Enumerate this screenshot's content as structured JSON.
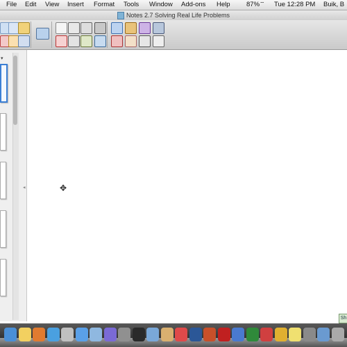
{
  "menubar": {
    "items": [
      "File",
      "Edit",
      "View",
      "Insert",
      "Format",
      "Tools",
      "Window",
      "Add-ons",
      "Help"
    ],
    "battery": "87%",
    "clock": "Tue 12:28 PM",
    "user": "Buik, B"
  },
  "window": {
    "title": "Notes 2.7 Solving Real Life Problems"
  },
  "sidebar": {
    "page_count_visible": 5,
    "selected_page": 1
  },
  "dock": {
    "apps": [
      "finder-icon",
      "notes-icon",
      "firefox-icon",
      "safari-icon",
      "launchpad-icon",
      "app-store-icon",
      "mail-icon",
      "itunes-icon",
      "system-prefs-icon",
      "dvd-icon",
      "preview-icon",
      "photo-icon",
      "calendar-icon",
      "word-icon",
      "powerpoint-icon",
      "acrobat-icon",
      "textedit-icon",
      "excel-icon",
      "ical-icon",
      "chrome-icon",
      "stickies-icon",
      "misc-icon",
      "folder-icon",
      "trash-icon"
    ]
  },
  "status_tag": "Sh"
}
